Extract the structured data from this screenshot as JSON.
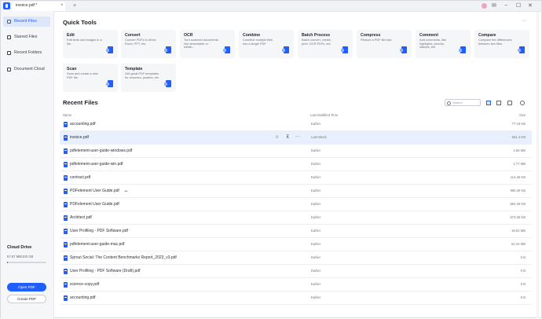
{
  "titlebar": {
    "tab_title": "invoice.pdf *",
    "tab_close": "×",
    "new_tab": "+",
    "icons": [
      "user-avatar",
      "mail-icon",
      "minimize-icon",
      "maximize-icon",
      "close-icon"
    ],
    "icon_glyphs": {
      "mail": "✉",
      "minimize": "−",
      "maximize": "☐",
      "close": "✕"
    }
  },
  "sidebar": {
    "items": [
      {
        "label": "Recent Files",
        "active": true
      },
      {
        "label": "Starred Files",
        "active": false
      },
      {
        "label": "Recent Folders",
        "active": false
      },
      {
        "label": "Document Cloud",
        "active": false
      }
    ],
    "cloud_title": "Cloud Drive",
    "cloud_usage": "57.67 MB/100 GB",
    "cloud_fraction": 0.0006,
    "open_pdf": "Open PDF",
    "create_pdf": "Create PDF"
  },
  "quick_tools": {
    "title": "Quick Tools",
    "more": "···",
    "cards": [
      {
        "title": "Edit",
        "desc": "Edit texts and images in a file."
      },
      {
        "title": "Convert",
        "desc": "Convert PDFs to Word, Excel, PPT, etc."
      },
      {
        "title": "OCR",
        "desc": "Turn scanned documents into searchable or editab..."
      },
      {
        "title": "Combine",
        "desc": "Combine multiple files into a single PDF."
      },
      {
        "title": "Batch Process",
        "desc": "Batch convert, create, print, OCR PDFs, etc."
      },
      {
        "title": "Compress",
        "desc": "Reduce a PDF file size."
      },
      {
        "title": "Comment",
        "desc": "Add comments, like highlights, pencils, stamps, etc."
      },
      {
        "title": "Compare",
        "desc": "Compare the differences between two files."
      },
      {
        "title": "Scan",
        "desc": "Scan and create a new PDF file."
      },
      {
        "title": "Template",
        "desc": "Get great PDF templates for resumes, posters, etc."
      }
    ]
  },
  "recent": {
    "title": "Recent Files",
    "search_placeholder": "Search",
    "columns": {
      "name": "Name",
      "time": "Last Modified Time",
      "size": "Size"
    },
    "row_actions": {
      "star": "☆",
      "pin": "⊼",
      "more": "···"
    },
    "cloud_mark": "☁",
    "files": [
      {
        "name": "accounting.pdf",
        "time": "Earlier",
        "size": "77.19 KB"
      },
      {
        "name": "invoice.pdf",
        "time": "Last Week",
        "size": "561.4 KB",
        "selected": true
      },
      {
        "name": "pdfelement-user-guide-windows.pdf",
        "time": "Earlier",
        "size": "4.66 MB"
      },
      {
        "name": "pdfelement-user-guide-win.pdf",
        "time": "Earlier",
        "size": "2.77 MB"
      },
      {
        "name": "contract.pdf",
        "time": "Earlier",
        "size": "114.25 KB"
      },
      {
        "name": "PDFelement User Guide.pdf",
        "time": "Earlier",
        "size": "990.29 KB",
        "cloud": true
      },
      {
        "name": "PDFelement User Guide.pdf",
        "time": "Earlier",
        "size": "994.29 KB"
      },
      {
        "name": "Architect.pdf",
        "time": "Earlier",
        "size": "573.06 KB"
      },
      {
        "name": "User Profiling - PDF Software.pdf",
        "time": "Earlier",
        "size": "16.02 MB"
      },
      {
        "name": "pdfelement-user-guide-mac.pdf",
        "time": "Earlier",
        "size": "52.44 MB"
      },
      {
        "name": "Sprout Social: The Content Benchmarks Report_2023_v3.pdf",
        "time": "Earlier",
        "size": "0 B"
      },
      {
        "name": "User Profiling - PDF Software (Draft).pdf",
        "time": "Earlier",
        "size": "0 B"
      },
      {
        "name": "science-copy.pdf",
        "time": "Earlier",
        "size": "0 B"
      },
      {
        "name": "accounting.pdf",
        "time": "Earlier",
        "size": "0 B"
      }
    ]
  }
}
